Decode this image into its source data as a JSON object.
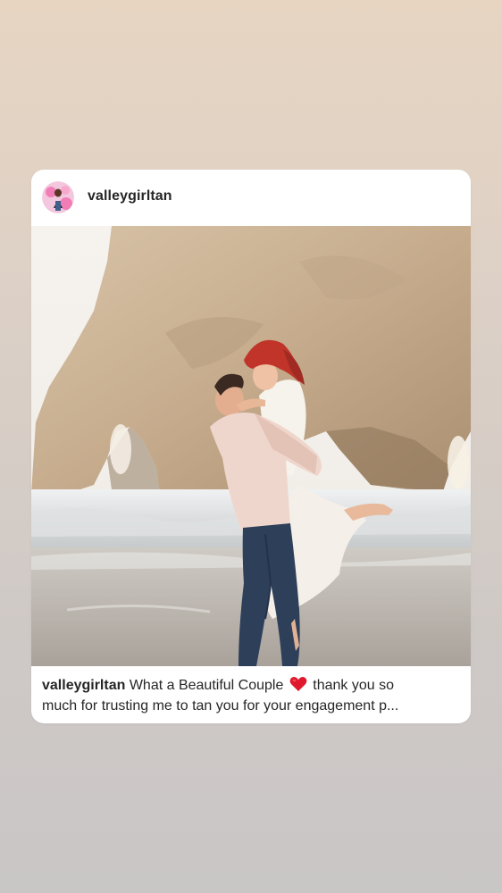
{
  "post": {
    "username": "valleygirltan",
    "avatar_icon": "profile-avatar-icon",
    "photo_icon": "couple-beach-photo",
    "caption": {
      "username": "valleygirltan",
      "text_before_emoji": "What a Beautiful Couple",
      "emoji_icon": "red-heart-icon",
      "text_after_emoji_line1": "thank you so",
      "text_line2": "much for trusting me to tan you for your engagement p..."
    }
  },
  "colors": {
    "background_top": "#e7d5c2",
    "background_bottom": "#c9c6c6",
    "card": "#ffffff",
    "text": "#262626",
    "heart": "#e0182d"
  }
}
